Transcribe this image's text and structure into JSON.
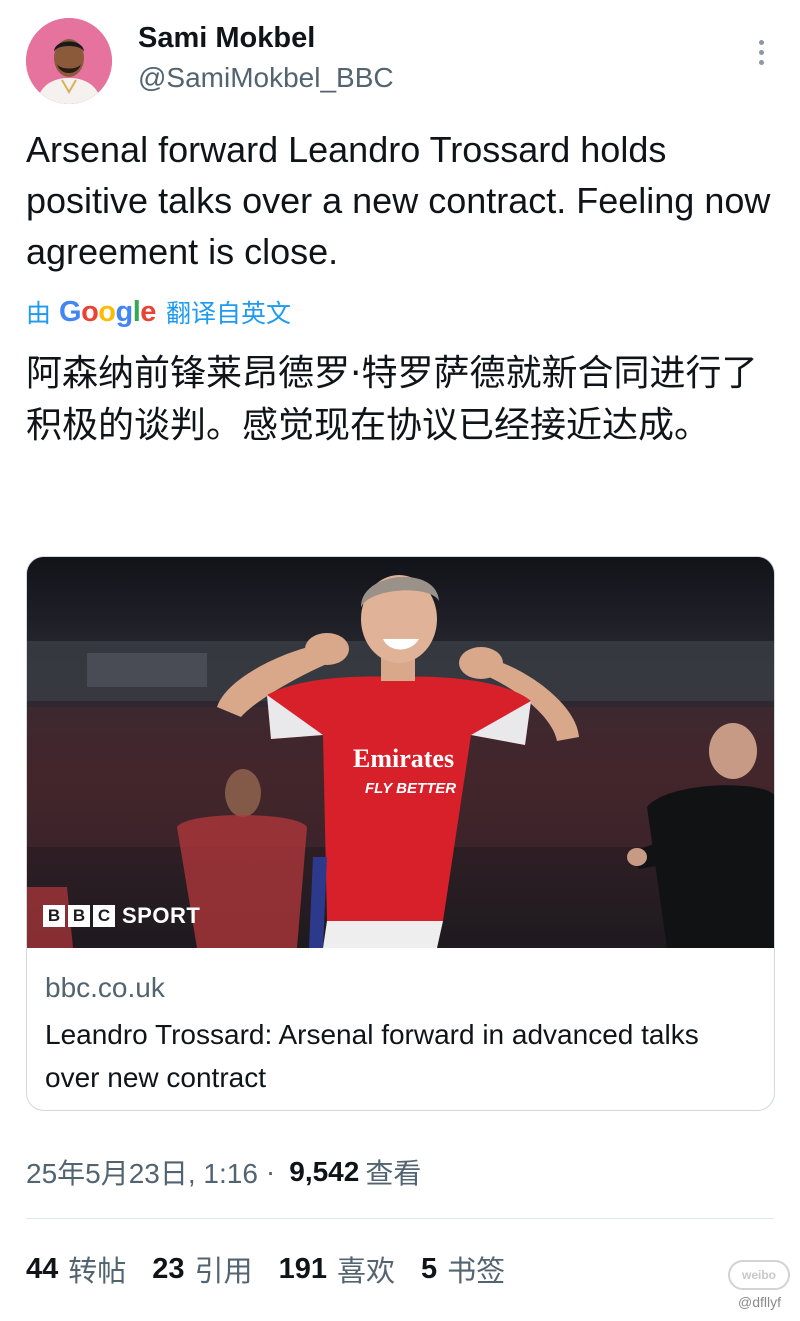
{
  "author": {
    "name": "Sami Mokbel",
    "handle": "@SamiMokbel_BBC"
  },
  "tweet": {
    "text": "Arsenal forward Leandro Trossard holds positive talks over a new contract. Feeling now agreement is close."
  },
  "translation": {
    "by": "由",
    "provider": [
      "G",
      "o",
      "o",
      "g",
      "l",
      "e"
    ],
    "from": "翻译自英文",
    "text": "阿森纳前锋莱昂德罗·特罗萨德就新合同进行了积极的谈判。感觉现在协议已经接近达成。"
  },
  "card": {
    "image_brand": {
      "boxes": [
        "B",
        "B",
        "C"
      ],
      "sport": "SPORT"
    },
    "jersey_text": {
      "line1": "Emirates",
      "line2": "FLY BETTER"
    },
    "domain": "bbc.co.uk",
    "title": "Leandro Trossard: Arsenal forward in advanced talks over new contract"
  },
  "meta": {
    "datetime": "25年5月23日, 1:16",
    "separator": "·",
    "views": "9,542",
    "views_label": "查看"
  },
  "stats": [
    {
      "num": "44",
      "label": "转帖"
    },
    {
      "num": "23",
      "label": "引用"
    },
    {
      "num": "191",
      "label": "喜欢"
    },
    {
      "num": "5",
      "label": "书签"
    }
  ],
  "watermark": {
    "badge": "weibo",
    "user": "@dfllyf"
  },
  "colors": {
    "link_blue": "#1d9bf0",
    "muted": "#536471",
    "text": "#0f1419",
    "arsenal_red": "#d8202a"
  },
  "icons": {
    "more": "more-vertical-icon"
  }
}
